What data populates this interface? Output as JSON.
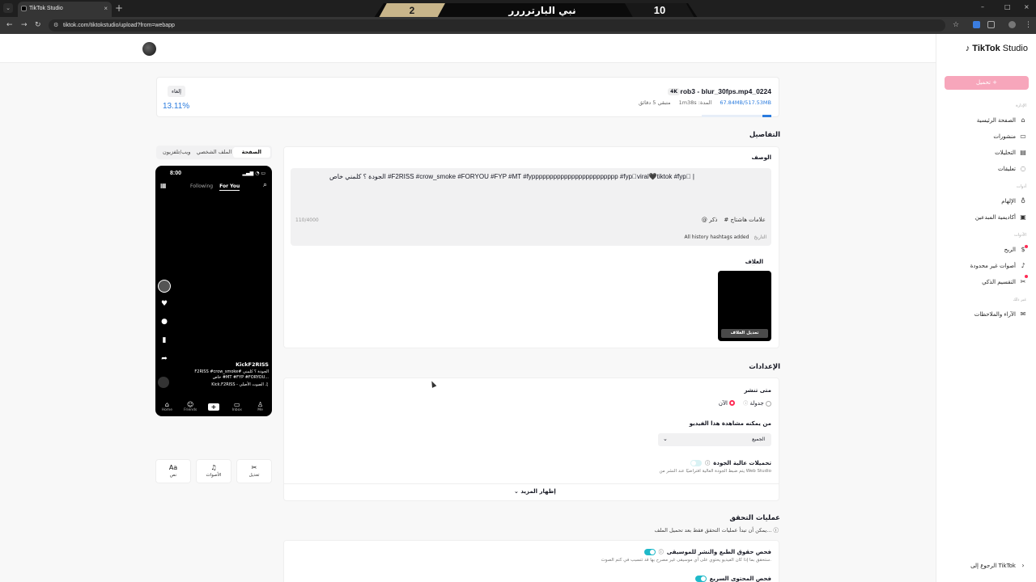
{
  "browser": {
    "tab_title": "TikTok Studio",
    "tab_close": "×",
    "new_tab": "+",
    "url": "tiktok.com/tiktokstudio/upload?from=webapp",
    "window_controls": [
      "–",
      "□",
      "×"
    ]
  },
  "scoreboard": {
    "left_score": "2",
    "player_name": "نبي البارترررر",
    "right_score": "10"
  },
  "sidebar": {
    "logo_main": "TikTok",
    "logo_sub": "Studio",
    "upload_label": "تحميل +",
    "sections": [
      "الإدارة",
      "أدوات",
      "الأدوات",
      "غير ذلك"
    ],
    "items": [
      {
        "label": "الصفحة الرئيسية",
        "icon": "home-icon"
      },
      {
        "label": "منشورات",
        "icon": "posts-icon"
      },
      {
        "label": "التحليلات",
        "icon": "analytics-icon"
      },
      {
        "label": "تعليقات",
        "icon": "comments-icon"
      },
      {
        "label": "الإلهام",
        "icon": "lightbulb-icon"
      },
      {
        "label": "أكاديمية المبدعين",
        "icon": "academy-icon"
      },
      {
        "label": "الربح",
        "icon": "monetize-icon"
      },
      {
        "label": "أصوات غير محدودة",
        "icon": "music-icon"
      },
      {
        "label": "التقسيم الذكي",
        "icon": "scissors-icon"
      },
      {
        "label": "الآراء والملاحظات",
        "icon": "feedback-icon"
      }
    ],
    "back_link": "الرجوع إلى TikTok"
  },
  "upload": {
    "file_name": "prob3 - blur_30fps.mp4_0224",
    "badge": "4K",
    "size": "67.84MB/517.53MB",
    "duration": "المدة: 1m38s",
    "remaining": "متبقي 5 دقائق",
    "cancel_label": "إلغاء",
    "percent_text": "13.11%",
    "progress": 0.1311
  },
  "preview": {
    "tabs": [
      "الصفحة",
      "الملف الشخصي",
      "ويب/تلفزيون"
    ],
    "time": "8:00",
    "feed_following": "Following",
    "feed_foryou": "For You",
    "username": "KickF2RISS",
    "caption": "F2RISS #crow_smoke# الجودة ؟ كلمني خاص #MT #FYP #FORYOU...",
    "sound": "Kick.F2RISS - الصوت الأصلي ♫",
    "nav": [
      "Home",
      "Friends",
      "+",
      "Inbox",
      "Me"
    ],
    "tools": [
      {
        "label": "نص",
        "icon": "Aa"
      },
      {
        "label": "الأصوات",
        "icon": "♫"
      },
      {
        "label": "تعديل",
        "icon": "✂"
      }
    ]
  },
  "details": {
    "section_title": "التفاصيل",
    "description_label": "الوصف",
    "description_text": "الجودة ؟ كلمني خاص #F2RISS #crow_smoke #FORYOU #FYP #MT #fypppppppppppppppppppppppp #fyp゚viral🖤tiktok #fyp゚ |",
    "counter": "110/4000",
    "hashtags_btn": "# علامات هاشتاج",
    "mention_btn": "@ ذكر",
    "history_label": "التاريخ",
    "history_value": "All history hashtags added",
    "cover_label": "الغلاف",
    "cover_btn": "تعديل الغلاف"
  },
  "settings": {
    "section_title": "الإعدادات",
    "when_label": "متى تنشر",
    "now_option": "الآن",
    "schedule_option": "جدولة",
    "who_label": "من يمكنه مشاهدة هذا الفيديو",
    "who_value": "الجميع",
    "hq_label": "تحميلات عالية الجودة",
    "hq_sub": "يتم ضبط الجودة العالية افتراضيًا عند النشر من Web Studio",
    "show_more": "إظهار المزيد"
  },
  "checks": {
    "section_title": "عمليات التحقق",
    "intro": "يمكن أن تبدأ عمليات التحقق فقط بعد تحميل الملف...",
    "music_label": "فحص حقوق الطبع والنشر للموسيقى",
    "music_sub": "ستحقق بما إذا كان الفيديو يحتوي على أي موسيقى غير مصرح بها قد تتسبب في كتم الصوت.",
    "content_label": "فحص المحتوى السريع"
  }
}
